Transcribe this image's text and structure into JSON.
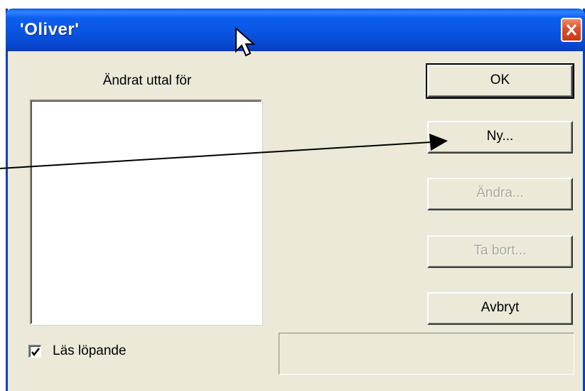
{
  "window": {
    "title": "'Oliver'"
  },
  "list": {
    "header": "Ändrat uttal för",
    "items": []
  },
  "buttons": {
    "ok": "OK",
    "new": "Ny...",
    "change": "Ändra...",
    "remove": "Ta bort...",
    "cancel": "Avbryt"
  },
  "options": {
    "read_continuous_label": "Läs löpande",
    "read_continuous_checked": true
  },
  "icons": {
    "close": "close-icon",
    "checkmark": "checkmark-icon",
    "cursor": "mouse-pointer-icon",
    "annotation": "arrow-annotation-icon"
  },
  "colors": {
    "titlebar": "#0a54e2",
    "close_button": "#dc4e2a",
    "dialog_background": "#ece9d8",
    "disabled_text": "#aca899"
  }
}
